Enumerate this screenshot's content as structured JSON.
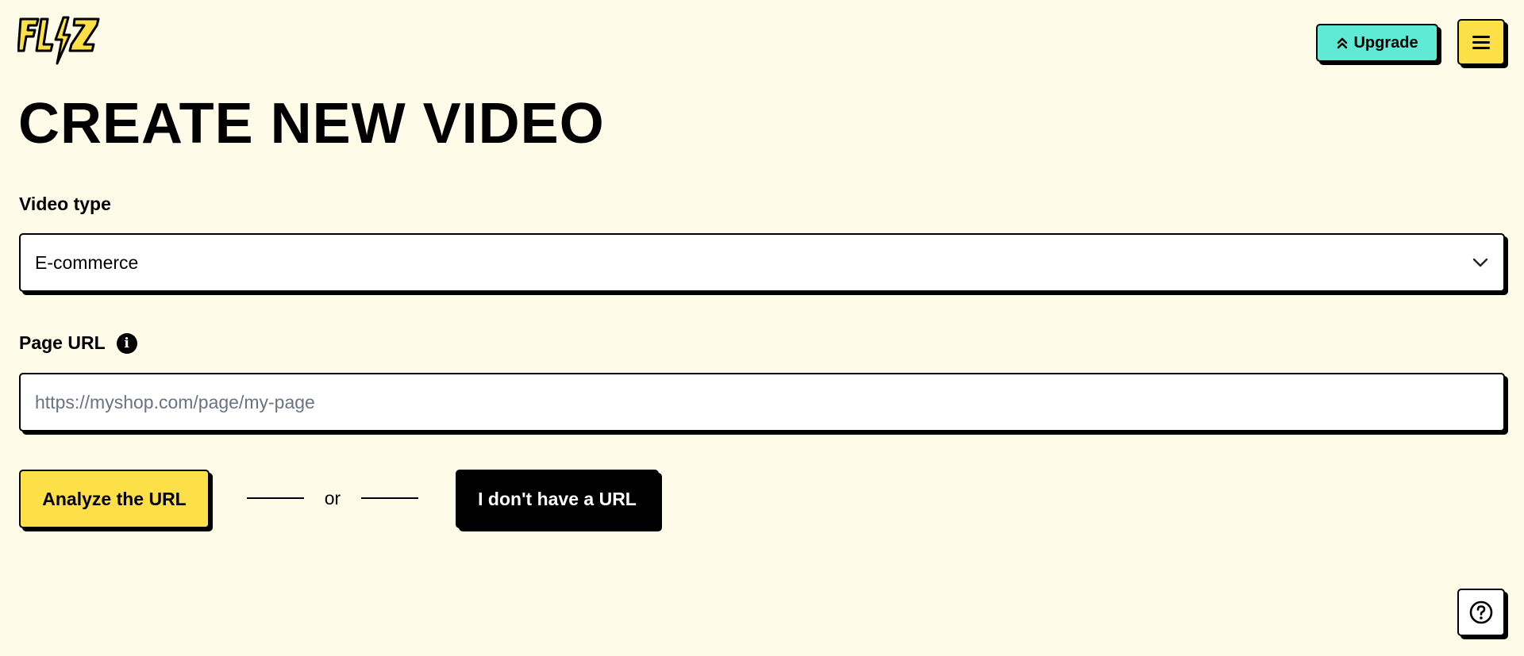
{
  "brand": {
    "logo_text": "FLIZ",
    "colors": {
      "background": "#fefce8",
      "accent_yellow": "#fde047",
      "accent_teal": "#5eead4",
      "ink": "#000000"
    }
  },
  "header": {
    "upgrade_label": "Upgrade",
    "upgrade_icon": "chevrons-up-icon",
    "menu_icon": "hamburger-menu-icon"
  },
  "main": {
    "title": "CREATE NEW VIDEO",
    "video_type": {
      "label": "Video type",
      "selected": "E-commerce",
      "icon": "chevron-down-icon"
    },
    "page_url": {
      "label": "Page URL",
      "info_icon": "info-icon",
      "info_glyph": "i",
      "value": "",
      "placeholder": "https://myshop.com/page/my-page"
    },
    "actions": {
      "analyze_label": "Analyze the URL",
      "or_text": "or",
      "no_url_label": "I don't have a URL"
    }
  },
  "help": {
    "icon": "help-circle-icon"
  }
}
